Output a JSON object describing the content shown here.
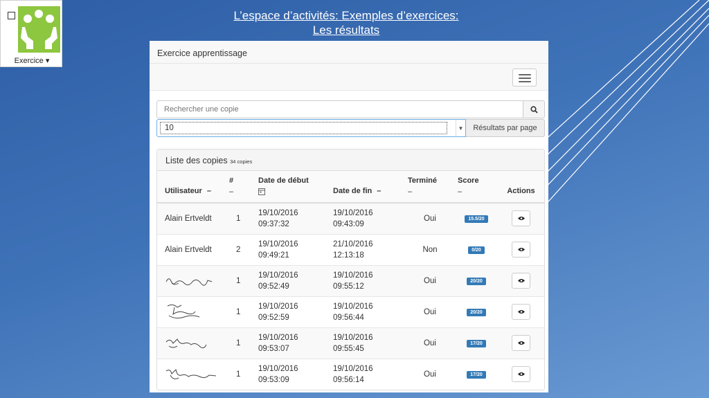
{
  "logo": {
    "label": "Exercice ▾",
    "accent": "#8dc63f"
  },
  "slide": {
    "title_line1": "L’espace d’activités: Exemples d’exercices:",
    "title_line2": "Les résultats"
  },
  "panel": {
    "header": "Exercice apprentissage"
  },
  "search": {
    "placeholder": "Rechercher une copie"
  },
  "page_size": {
    "value": "10",
    "addon_label": "Résultats par page"
  },
  "list": {
    "title": "Liste des copies",
    "count": "34 copies",
    "columns": {
      "user": "Utilisateur",
      "user_sort": "–",
      "num": "#",
      "num_sort": "–",
      "start": "Date de début",
      "end": "Date de fin",
      "end_sort": "–",
      "done": "Terminé",
      "done_sort": "–",
      "score": "Score",
      "score_sort": "–",
      "actions": "Actions"
    },
    "rows": [
      {
        "user": "Alain Ertveldt",
        "num": "1",
        "start_date": "19/10/2016",
        "start_time": "09:37:32",
        "end_date": "19/10/2016",
        "end_time": "09:43:09",
        "done": "Oui",
        "score": "15.5/20"
      },
      {
        "user": "Alain Ertveldt",
        "num": "2",
        "start_date": "19/10/2016",
        "start_time": "09:49:21",
        "end_date": "21/10/2016",
        "end_time": "12:13:18",
        "done": "Non",
        "score": "0/20"
      },
      {
        "user": "",
        "num": "1",
        "start_date": "19/10/2016",
        "start_time": "09:52:49",
        "end_date": "19/10/2016",
        "end_time": "09:55:12",
        "done": "Oui",
        "score": "20/20"
      },
      {
        "user": "",
        "num": "1",
        "start_date": "19/10/2016",
        "start_time": "09:52:59",
        "end_date": "19/10/2016",
        "end_time": "09:56:44",
        "done": "Oui",
        "score": "20/20"
      },
      {
        "user": "",
        "num": "1",
        "start_date": "19/10/2016",
        "start_time": "09:53:07",
        "end_date": "19/10/2016",
        "end_time": "09:55:45",
        "done": "Oui",
        "score": "17/20"
      },
      {
        "user": "",
        "num": "1",
        "start_date": "19/10/2016",
        "start_time": "09:53:09",
        "end_date": "19/10/2016",
        "end_time": "09:56:14",
        "done": "Oui",
        "score": "17/20"
      }
    ]
  },
  "icons": {
    "search": "search-icon",
    "view": "eye-icon",
    "menu": "hamburger-menu-icon",
    "calendar": "calendar-icon"
  },
  "colors": {
    "badge": "#337ab7",
    "focus": "#66afe9"
  }
}
